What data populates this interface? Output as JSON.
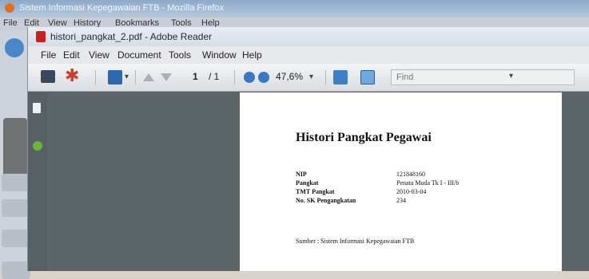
{
  "browser": {
    "title": "Sistem Informasi Kepegawaian FTB - Mozilla Firefox",
    "menu": [
      "File",
      "Edit",
      "View",
      "History",
      "Bookmarks",
      "Tools",
      "Help"
    ]
  },
  "reader": {
    "title": "histori_pangkat_2.pdf - Adobe Reader",
    "menu": [
      "File",
      "Edit",
      "View",
      "Document",
      "Tools",
      "Window",
      "Help"
    ],
    "toolbar": {
      "page_current": "1",
      "page_total": "/ 1",
      "zoom": "47,6%",
      "find_placeholder": "Find"
    }
  },
  "document": {
    "title": "Histori Pangkat Pegawai",
    "fields": [
      {
        "label": "NIP",
        "value": "121848160"
      },
      {
        "label": "Pangkat",
        "value": "Penata Muda Tk I - III/b"
      },
      {
        "label": "TMT Pangkat",
        "value": "2010-03-04"
      },
      {
        "label": "No. SK Pengangkatan",
        "value": "234"
      }
    ],
    "source": "Sumber : Sistem Informasi Kepegawaian FTB"
  },
  "colors": {
    "canvas": "#5b6467",
    "page": "#ffffff",
    "reader_accent": "#c8201b"
  }
}
